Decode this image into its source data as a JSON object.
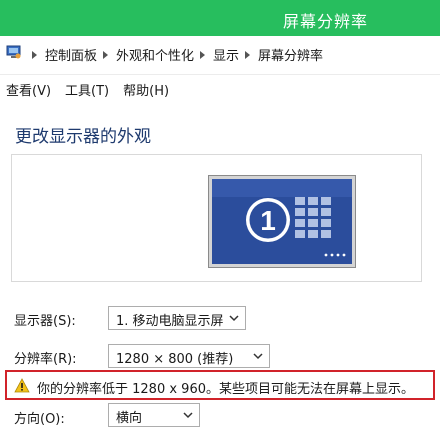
{
  "window": {
    "title": "屏幕分辨率"
  },
  "breadcrumb": {
    "items": [
      "控制面板",
      "外观和个性化",
      "显示",
      "屏幕分辨率"
    ]
  },
  "menu": {
    "items": [
      "查看(V)",
      "工具(T)",
      "帮助(H)"
    ]
  },
  "page": {
    "heading": "更改显示器的外观"
  },
  "preview": {
    "display_number": "1"
  },
  "settings": {
    "display": {
      "label": "显示器(S):",
      "value": "1. 移动电脑显示屏"
    },
    "resolution": {
      "label": "分辨率(R):",
      "value": "1280 × 800 (推荐)"
    },
    "warning": "你的分辨率低于 1280 x 960。某些项目可能无法在屏幕上显示。",
    "orientation": {
      "label": "方向(O):",
      "value": "横向"
    }
  },
  "colors": {
    "title_bar": "#27be5e",
    "warning_border": "#d1232a",
    "heading": "#1e3a6e",
    "monitor_screen": "#2b4d9c",
    "warning_icon": "#f2c21b"
  },
  "icons": [
    "control-panel-icon",
    "breadcrumb-separator-icon",
    "monitor-icon",
    "chevron-down-icon",
    "warning-icon"
  ]
}
